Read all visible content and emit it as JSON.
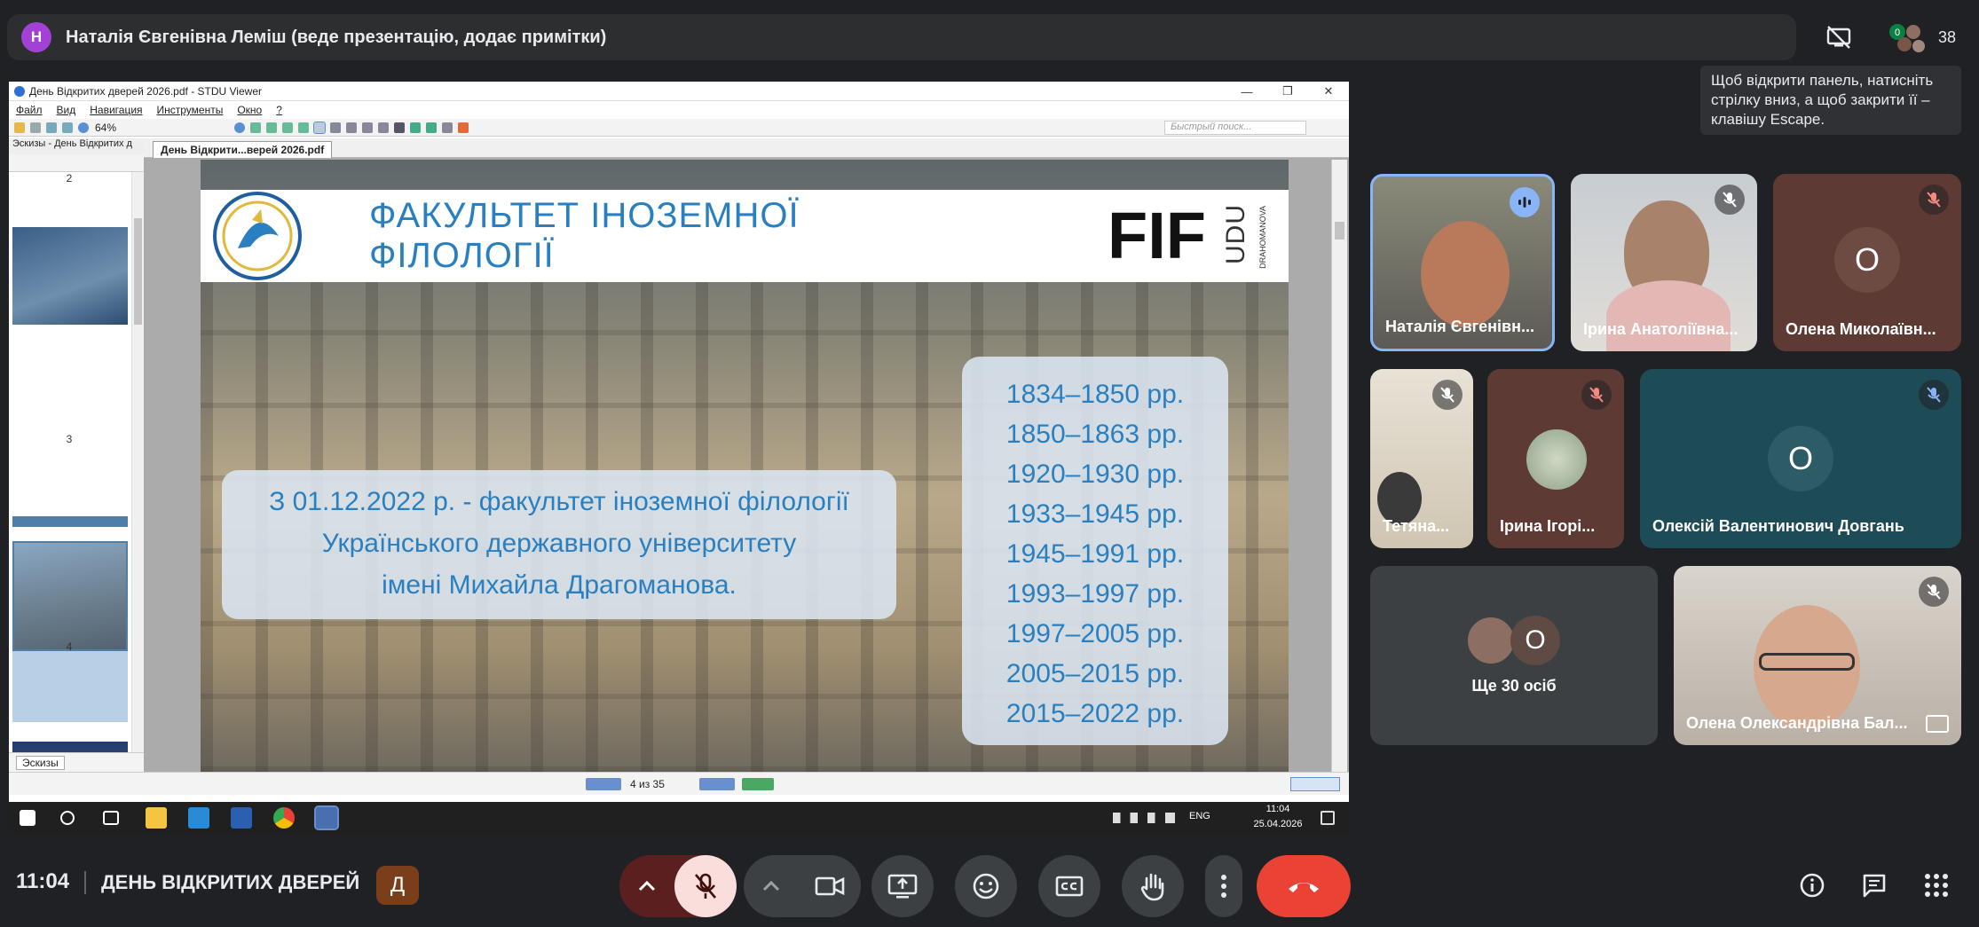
{
  "presenter": {
    "initial": "Н",
    "label": "Наталія Євгенівна Леміш (веде презентацію, додає примітки)",
    "avatar_color": "#a142d4"
  },
  "people": {
    "badge": "0",
    "count": "38"
  },
  "tooltip": {
    "text": "Щоб відкрити панель, натисніть стрілку вниз, а щоб закрити її – клавішу Escape."
  },
  "stdu": {
    "window_title": "День Відкритих дверей 2026.pdf - STDU Viewer",
    "menu": [
      "Файл",
      "Вид",
      "Навигация",
      "Инструменты",
      "Окно",
      "?"
    ],
    "zoom": "64%",
    "search_placeholder": "Быстрый поиск...",
    "thumb_header": "Эскизы - День Відкритих д",
    "thumb_numbers": [
      "2",
      "3",
      "4"
    ],
    "thumb_tab_label": "Эскизы",
    "doc_tab": "День Відкрити...верей 2026.pdf",
    "page_indicator": "4 из 35"
  },
  "slide": {
    "title": "ФАКУЛЬТЕТ ІНОЗЕМНОЇ ФІЛОЛОГІЇ",
    "logo_fif": "FIF",
    "logo_udu": "UDU",
    "logo_drag": "DRAHOMANOVA",
    "info_lines": [
      "З  01.12.2022 р. -  факультет іноземної філології",
      "Українського державного університету",
      "імені Михайла Драгоманова."
    ],
    "dates": [
      "1834–1850 рр.",
      "1850–1863 рр.",
      "1920–1930 рр.",
      "1933–1945 рр.",
      "1945–1991 рр.",
      "1993–1997 рр.",
      "1997–2005 рр.",
      "2005–2015 рр.",
      "2015–2022  рр."
    ]
  },
  "taskbar": {
    "lang": "ENG",
    "time": "11:04",
    "date": "25.04.2026"
  },
  "tiles": [
    {
      "name": "Наталія Євгенівн..."
    },
    {
      "name": "Ірина Анатоліївна..."
    },
    {
      "name": "Олена Миколаївн...",
      "initial": "О"
    },
    {
      "name": "Тетяна..."
    },
    {
      "name": "Ірина Ігорі..."
    },
    {
      "name": "Олексій Валентинович Довгань",
      "initial": "О"
    },
    {
      "name": "Ще 30 осіб",
      "initial": "О"
    },
    {
      "name": "Олена Олександрівна Бал..."
    }
  ],
  "meeting": {
    "time": "11:04",
    "title": "ДЕНЬ ВІДКРИТИХ ДВЕРЕЙ",
    "chip": "Д"
  },
  "colors": {
    "end_call": "#ea4335",
    "mic_off_bg": "#f9dedc",
    "mic_chip": "#5c1f1f",
    "slide_blue": "#2a7fc1"
  }
}
